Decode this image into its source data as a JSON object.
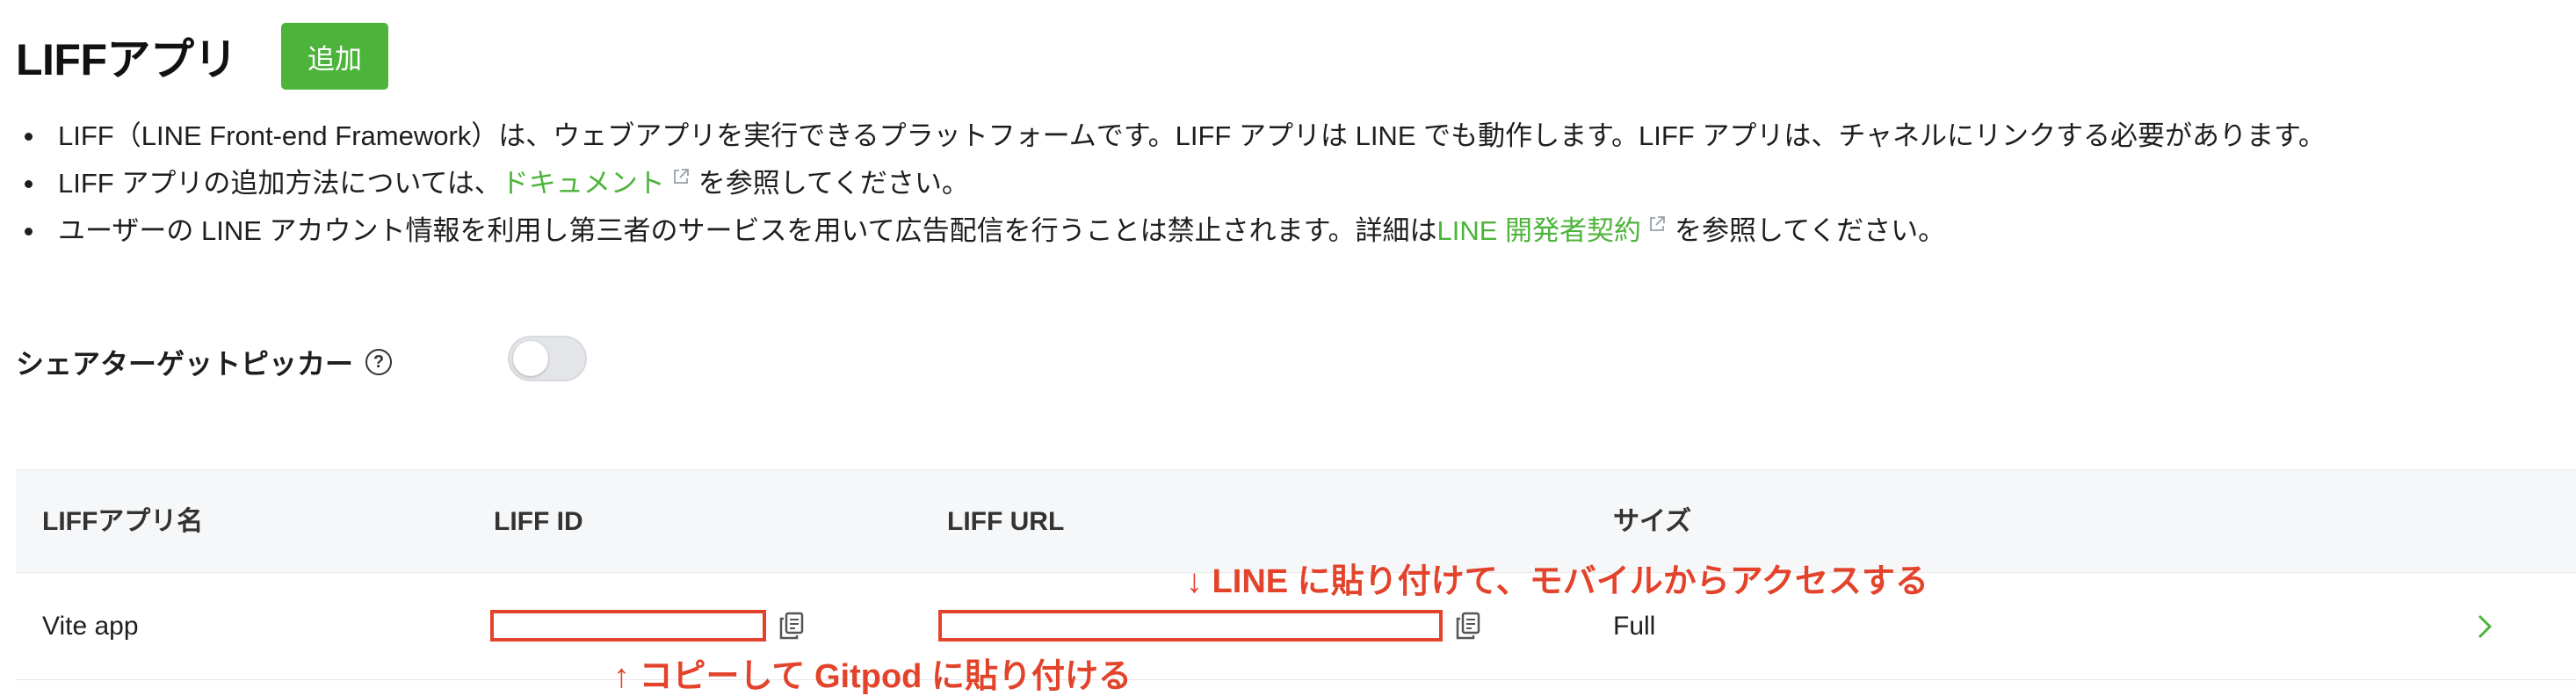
{
  "header": {
    "title": "LIFFアプリ",
    "add_label": "追加"
  },
  "notes": {
    "line1": "LIFF（LINE Front-end Framework）は、ウェブアプリを実行できるプラットフォームです。LIFF アプリは LINE でも動作します。LIFF アプリは、チャネルにリンクする必要があります。",
    "line2_before": "LIFF アプリの追加方法については、",
    "line2_link": "ドキュメント",
    "line2_after": "を参照してください。",
    "line3_before": "ユーザーの LINE アカウント情報を利用し第三者のサービスを用いて広告配信を行うことは禁止されます。詳細は",
    "line3_link": "LINE 開発者契約",
    "line3_after": "を参照してください。"
  },
  "share_target": {
    "label": "シェアターゲットピッカー",
    "help": "?",
    "enabled": false
  },
  "table": {
    "headers": [
      "LIFFアプリ名",
      "LIFF ID",
      "LIFF URL",
      "サイズ"
    ],
    "row": {
      "name": "Vite app",
      "size": "Full"
    }
  },
  "annotations": {
    "line_note": "↓ LINE に貼り付けて、モバイルからアクセスする",
    "gitpod_note": "↑ コピーして Gitpod に貼り付ける"
  },
  "colors": {
    "accent": "#4cb43a",
    "annotation": "#e2432a"
  }
}
